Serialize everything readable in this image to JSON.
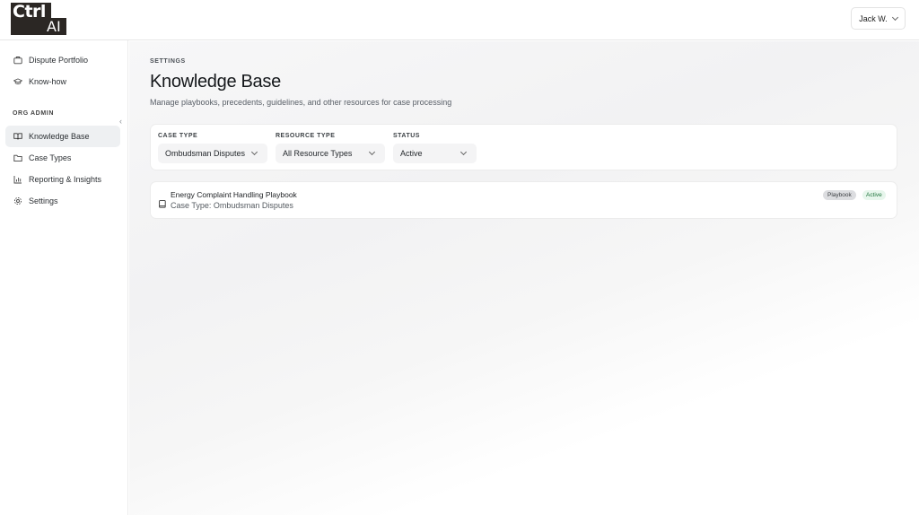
{
  "brand": {
    "line1": "Ctrl",
    "line2": "AI"
  },
  "user": {
    "name": "Jack W."
  },
  "sidebar": {
    "top_items": [
      {
        "label": "Dispute Portfolio",
        "icon": "briefcase-icon"
      },
      {
        "label": "Know-how",
        "icon": "graduation-cap-icon"
      }
    ],
    "section_label": "ORG ADMIN",
    "admin_items": [
      {
        "label": "Knowledge Base",
        "icon": "book-open-icon",
        "active": true
      },
      {
        "label": "Case Types",
        "icon": "folder-icon"
      },
      {
        "label": "Reporting & Insights",
        "icon": "bar-chart-icon"
      },
      {
        "label": "Settings",
        "icon": "gear-icon"
      }
    ],
    "collapse_glyph": "‹"
  },
  "page": {
    "eyebrow": "SETTINGS",
    "title": "Knowledge Base",
    "subtitle": "Manage playbooks, precedents, guidelines, and other resources for case processing"
  },
  "filters": [
    {
      "label": "CASE TYPE",
      "value": "Ombudsman Disputes"
    },
    {
      "label": "RESOURCE TYPE",
      "value": "All Resource Types"
    },
    {
      "label": "STATUS",
      "value": "Active"
    }
  ],
  "resources": [
    {
      "name": "Energy Complaint Handling Playbook",
      "case_type_line": "Case Type: Ombudsman Disputes",
      "type_badge": "Playbook",
      "status_badge": "Active"
    }
  ],
  "colors": {
    "brand_dark": "#2b2724",
    "active_nav_bg": "#eef0f2",
    "status_green_bg": "#e7f6ec",
    "status_green_text": "#22763e",
    "badge_gray_bg": "#dcdde0"
  }
}
